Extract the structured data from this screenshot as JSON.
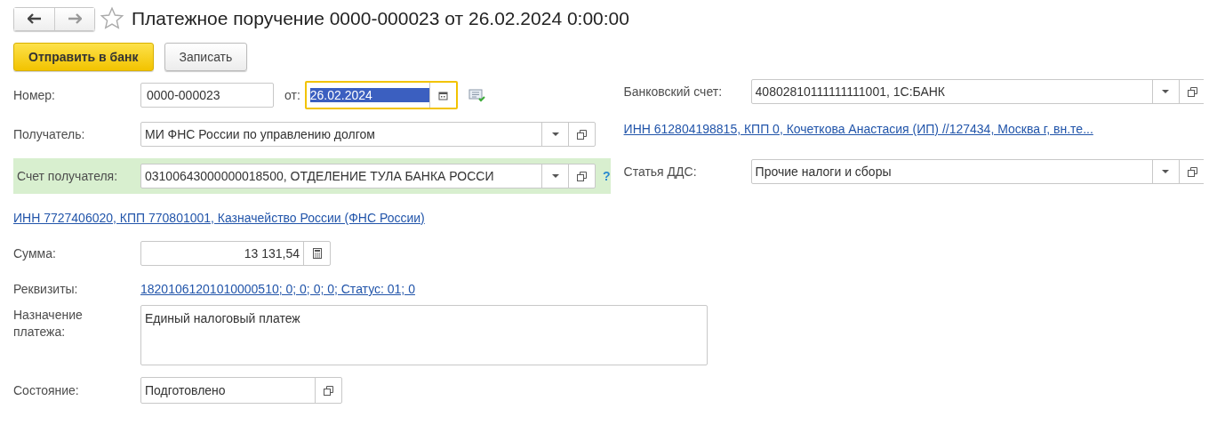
{
  "title": "Платежное поручение 0000-000023 от 26.02.2024 0:00:00",
  "buttons": [
    {
      "label": "Отправить в банк",
      "kind": "primary"
    },
    {
      "label": "Записать",
      "kind": "default"
    }
  ],
  "number": {
    "label": "Номер:",
    "value": "0000-000023"
  },
  "date": {
    "label": "от:",
    "value": "26.02.2024",
    "focused": true
  },
  "recipient": {
    "label": "Получатель:",
    "value": "МИ ФНС России по управлению долгом"
  },
  "recipient_account": {
    "label": "Счет получателя:",
    "value": "03100643000000018500, ОТДЕЛЕНИЕ ТУЛА БАНКА РОССИ",
    "highlighted": true,
    "help": "?"
  },
  "recipient_link": "ИНН 7727406020, КПП 770801001, Казначейство России (ФНС России)",
  "bank_account": {
    "label": "Банковский счет:",
    "value": "40802810111111111001, 1С:БАНК"
  },
  "bank_link": "ИНН 612804198815, КПП 0, Кочеткова Анастасия (ИП) //127434, Москва г, вн.те...",
  "dds": {
    "label": "Статья ДДС:",
    "value": "Прочие налоги и сборы"
  },
  "amount": {
    "label": "Сумма:",
    "value": "13 131,54"
  },
  "requisites": {
    "label": "Реквизиты:",
    "link": "18201061201010000510; 0; 0; 0; 0; Статус: 01; 0"
  },
  "purpose": {
    "label": "Назначение платежа:",
    "value": "Единый налоговый платеж"
  },
  "status": {
    "label": "Состояние:",
    "value": "Подготовлено"
  }
}
